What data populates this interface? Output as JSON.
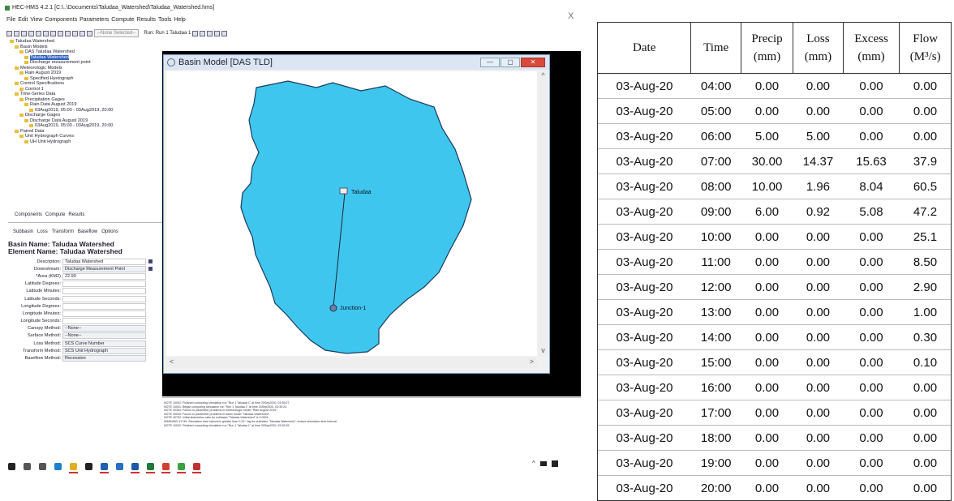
{
  "app": {
    "title": "HEC-HMS 4.2.1 [C:\\..\\Documents\\Taludaa_Watershed\\Taludaa_Watershed.hms]",
    "close_glyph": "X"
  },
  "menu": [
    "File",
    "Edit",
    "View",
    "Components",
    "Parameters",
    "Compute",
    "Results",
    "Tools",
    "Help"
  ],
  "toolbar": {
    "selector": "--None Selected--",
    "run": "Run: Run 1 Taludaa 1"
  },
  "tree": [
    {
      "label": "Taludaa Watershed",
      "level": 0
    },
    {
      "label": "Basin Models",
      "level": 1
    },
    {
      "label": "DAS Taludaa Watershed",
      "level": 2
    },
    {
      "label": "Taludaa Watershed",
      "level": 3,
      "selected": true
    },
    {
      "label": "Discharge measurement point",
      "level": 3
    },
    {
      "label": "Meteorologic Models",
      "level": 1
    },
    {
      "label": "Rain August 2019",
      "level": 2
    },
    {
      "label": "Specified Hyetograph",
      "level": 3
    },
    {
      "label": "Control Specifications",
      "level": 1
    },
    {
      "label": "Control 1",
      "level": 2
    },
    {
      "label": "Time-Series Data",
      "level": 1
    },
    {
      "label": "Precipitation Gages",
      "level": 2
    },
    {
      "label": "Rain Data August 2019",
      "level": 3
    },
    {
      "label": "03Aug2019, 05:00 - 03Aug2019, 20:00",
      "level": 4
    },
    {
      "label": "Discharge Gages",
      "level": 2
    },
    {
      "label": "Discharge Data August 2019",
      "level": 3
    },
    {
      "label": "03Aug2019, 05:00 - 03Aug2019, 20:00",
      "level": 4
    },
    {
      "label": "Paired Data",
      "level": 1
    },
    {
      "label": "Unit Hydrograph Curves",
      "level": 2
    },
    {
      "label": "UH Unit Hydrograph",
      "level": 3
    }
  ],
  "bottom_tabs": [
    "Components",
    "Compute",
    "Results"
  ],
  "subbasin_tabs": [
    "Subbasin",
    "Loss",
    "Transform",
    "Baseflow",
    "Options"
  ],
  "props": {
    "basin_name_label": "Basin Name:",
    "basin_name": "Taludaa Watershed",
    "element_name_label": "Element Name:",
    "element_name": "Taludaa Watershed",
    "rows": [
      {
        "label": "Description:",
        "value": "Taludaa Watershed",
        "type": "text"
      },
      {
        "label": "Downstream:",
        "value": "Discharge Measurement Point",
        "type": "dropdown"
      },
      {
        "label": "*Area (KM2)",
        "value": "22.99",
        "type": "text"
      },
      {
        "label": "Latitude Degrees:",
        "value": "",
        "type": "text"
      },
      {
        "label": "Latitude Minutes:",
        "value": "",
        "type": "text"
      },
      {
        "label": "Latitude Seconds:",
        "value": "",
        "type": "text"
      },
      {
        "label": "Longitude Degrees:",
        "value": "",
        "type": "text"
      },
      {
        "label": "Longitude Minutes:",
        "value": "",
        "type": "text"
      },
      {
        "label": "Longitude Seconds:",
        "value": "",
        "type": "text"
      },
      {
        "label": "Canopy Method:",
        "value": "--None--",
        "type": "dropdown"
      },
      {
        "label": "Surface Method:",
        "value": "--None--",
        "type": "dropdown"
      },
      {
        "label": "Loss Method:",
        "value": "SCS Curve Number",
        "type": "dropdown"
      },
      {
        "label": "Transform Method:",
        "value": "SCS Unit Hydrograph",
        "type": "dropdown"
      },
      {
        "label": "Baseflow Method:",
        "value": "Recession",
        "type": "dropdown"
      }
    ]
  },
  "basin_window": {
    "title": "Basin Model [DAS TLD]",
    "minimize": "—",
    "maximize": "▢",
    "close": "✕",
    "node_subbasin": "Taludaa",
    "node_junction": "Junction-1",
    "watershed_color": "#3fc6ee"
  },
  "log": [
    "NOTE 10002: Finished computing simulation run \"Run 1 Taludaa 1\" at time 20Sep2020, 03:35:07.",
    "NOTE 10001: Began computing simulation run \"Run 1 Taludaa 1\" at time 20Sep2020, 03:39:24.",
    "NOTE 20364: Found no parameter problems in meteorologic model \"Rain August 2019\".",
    "NOTE 40049: Found no parameter problems in basin model \"Taludaa Watershed\".",
    "NOTE 40702: Initial abstraction ratio for subbasin \"Taludaa Watershed\" is 0.0004.",
    "WARNING 41749: Simulation time interval is greater than 0.29 * lag for subbasin \"Taludaa Watershed\"; reduce simulation time interval.",
    "NOTE 10002: Finished computing simulation run \"Run 1 Taludaa 1\" at time 20Sep2020, 03:39:26."
  ],
  "table": {
    "headers": [
      {
        "l1": "Date",
        "l2": ""
      },
      {
        "l1": "Time",
        "l2": ""
      },
      {
        "l1": "Precip",
        "l2": "(mm)"
      },
      {
        "l1": "Loss",
        "l2": "(mm)"
      },
      {
        "l1": "Excess",
        "l2": "(mm)"
      },
      {
        "l1": "Flow",
        "l2": "(M³/s)"
      }
    ],
    "rows": [
      [
        "03-Aug-20",
        "04:00",
        "0.00",
        "0.00",
        "0.00",
        "0.00"
      ],
      [
        "03-Aug-20",
        "05:00",
        "0.00",
        "0.00",
        "0.00",
        "0.00"
      ],
      [
        "03-Aug-20",
        "06:00",
        "5.00",
        "5.00",
        "0.00",
        "0.00"
      ],
      [
        "03-Aug-20",
        "07:00",
        "30.00",
        "14.37",
        "15.63",
        "37.9"
      ],
      [
        "03-Aug-20",
        "08:00",
        "10.00",
        "1.96",
        "8.04",
        "60.5"
      ],
      [
        "03-Aug-20",
        "09:00",
        "6.00",
        "0.92",
        "5.08",
        "47.2"
      ],
      [
        "03-Aug-20",
        "10:00",
        "0.00",
        "0.00",
        "0.00",
        "25.1"
      ],
      [
        "03-Aug-20",
        "11:00",
        "0.00",
        "0.00",
        "0.00",
        "8.50"
      ],
      [
        "03-Aug-20",
        "12:00",
        "0.00",
        "0.00",
        "0.00",
        "2.90"
      ],
      [
        "03-Aug-20",
        "13:00",
        "0.00",
        "0.00",
        "0.00",
        "1.00"
      ],
      [
        "03-Aug-20",
        "14:00",
        "0.00",
        "0.00",
        "0.00",
        "0.30"
      ],
      [
        "03-Aug-20",
        "15:00",
        "0.00",
        "0.00",
        "0.00",
        "0.10"
      ],
      [
        "03-Aug-20",
        "16:00",
        "0.00",
        "0.00",
        "0.00",
        "0.00"
      ],
      [
        "03-Aug-20",
        "17:00",
        "0.00",
        "0.00",
        "0.00",
        "0.00"
      ],
      [
        "03-Aug-20",
        "18:00",
        "0.00",
        "0.00",
        "0.00",
        "0.00"
      ],
      [
        "03-Aug-20",
        "19:00",
        "0.00",
        "0.00",
        "0.00",
        "0.00"
      ],
      [
        "03-Aug-20",
        "20:00",
        "0.00",
        "0.00",
        "0.00",
        "0.00"
      ]
    ]
  },
  "taskbar": {
    "icons": [
      {
        "name": "start-icon",
        "color": "#222",
        "u": false
      },
      {
        "name": "search-icon",
        "color": "#555",
        "u": false
      },
      {
        "name": "task-view-icon",
        "color": "#555",
        "u": false
      },
      {
        "name": "edge-icon",
        "color": "#1e7fd0",
        "u": false
      },
      {
        "name": "folder-icon",
        "color": "#e0b020",
        "u": true
      },
      {
        "name": "store-icon",
        "color": "#222",
        "u": false
      },
      {
        "name": "mail-icon",
        "color": "#1e5fb0",
        "u": true
      },
      {
        "name": "app-icon",
        "color": "#2a6fc0",
        "u": false
      },
      {
        "name": "outlook-icon",
        "color": "#1a5aa8",
        "u": true
      },
      {
        "name": "excel-icon",
        "color": "#1f7a3a",
        "u": true
      },
      {
        "name": "chrome-icon",
        "color": "#d04030",
        "u": true
      },
      {
        "name": "hms-icon",
        "color": "#3aa040",
        "u": true
      },
      {
        "name": "pdf-icon",
        "color": "#c03030",
        "u": true
      }
    ],
    "tray_caret": "^"
  }
}
